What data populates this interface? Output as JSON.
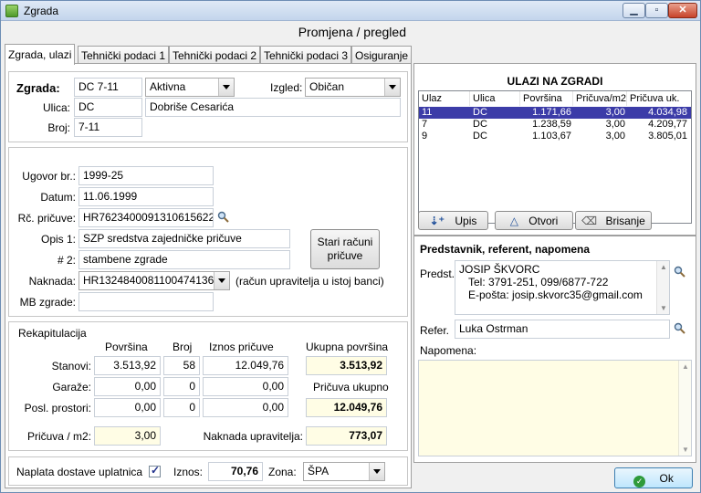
{
  "window": {
    "title": "Zgrada",
    "header": "Promjena / pregled"
  },
  "tabs": [
    {
      "label": "Zgrada, ulazi"
    },
    {
      "label": "Tehnički podaci 1"
    },
    {
      "label": "Tehnički podaci 2"
    },
    {
      "label": "Tehnički podaci 3"
    },
    {
      "label": "Osiguranje"
    }
  ],
  "building": {
    "zgrada_label": "Zgrada:",
    "zgrada_value": "DC 7-11",
    "status_value": "Aktivna",
    "izgled_label": "Izgled:",
    "izgled_value": "Običan",
    "ulica_label": "Ulica:",
    "ulica_code": "DC",
    "ulica_name": "Dobriše Cesarića",
    "broj_label": "Broj:",
    "broj_value": "7-11"
  },
  "contract": {
    "ugovor_label": "Ugovor br.:",
    "ugovor_value": "1999-25",
    "datum_label": "Datum:",
    "datum_value": "11.06.1999",
    "rc_label": "Rč. pričuve:",
    "rc_value": "HR7623400091310615622",
    "opis1_label": "Opis 1:",
    "opis1_value": "SZP sredstva zajedničke pričuve",
    "opis2_label": "# 2:",
    "opis2_value": "stambene zgrade",
    "stari_button": "Stari računi pričuve",
    "naknada_label": "Naknada:",
    "naknada_value": "HR1324840081100474136",
    "naknada_note": "(račun upravitelja u istoj banci)",
    "mb_label": "MB zgrade:",
    "mb_value": ""
  },
  "recap": {
    "title": "Rekapitulacija",
    "headers": {
      "povrsina": "Površina",
      "broj": "Broj",
      "iznos": "Iznos pričuve",
      "ukupna": "Ukupna površina"
    },
    "rows": [
      {
        "label": "Stanovi:",
        "povrsina": "3.513,92",
        "broj": "58",
        "iznos": "12.049,76"
      },
      {
        "label": "Garaže:",
        "povrsina": "0,00",
        "broj": "0",
        "iznos": "0,00"
      },
      {
        "label": "Posl. prostori:",
        "povrsina": "0,00",
        "broj": "0",
        "iznos": "0,00"
      }
    ],
    "ukupna_value": "3.513,92",
    "pricuva_ukupno_label": "Pričuva ukupno",
    "pricuva_ukupno_value": "12.049,76"
  },
  "rates": {
    "pricuva_m2_label": "Pričuva / m2:",
    "pricuva_m2_value": "3,00",
    "naknada_label": "Naknada upravitelja:",
    "naknada_value": "773,07"
  },
  "delivery": {
    "label": "Naplata dostave uplatnica",
    "checked": true,
    "iznos_label": "Iznos:",
    "iznos_value": "70,76",
    "zona_label": "Zona:",
    "zona_value": "ŠPA"
  },
  "entrances": {
    "title": "ULAZI NA ZGRADI",
    "columns": [
      "Ulaz",
      "Ulica",
      "Površina",
      "Pričuva/m2",
      "Pričuva uk."
    ],
    "rows": [
      {
        "ulaz": "11",
        "ulica": "DC",
        "povrsina": "1.171,66",
        "pricuva_m2": "3,00",
        "pricuva_uk": "4.034,98"
      },
      {
        "ulaz": "7",
        "ulica": "DC",
        "povrsina": "1.238,59",
        "pricuva_m2": "3,00",
        "pricuva_uk": "4.209,77"
      },
      {
        "ulaz": "9",
        "ulica": "DC",
        "povrsina": "1.103,67",
        "pricuva_m2": "3,00",
        "pricuva_uk": "3.805,01"
      }
    ],
    "buttons": {
      "upis": "Upis",
      "otvori": "Otvori",
      "brisanje": "Brisanje"
    }
  },
  "representative": {
    "title": "Predstavnik, referent, napomena",
    "predst_label": "Predst.",
    "predst_lines": [
      "JOSIP ŠKVORC",
      "Tel: 3791-251, 099/6877-722",
      "E-pošta: josip.skvorc35@gmail.com"
    ],
    "refer_label": "Refer.",
    "refer_value": "Luka Ostrman",
    "napomena_label": "Napomena:",
    "napomena_value": ""
  },
  "footer": {
    "ok_label": "Ok"
  },
  "colors": {
    "selection": "#3c3ca8",
    "highlight_field": "#fffde5",
    "title_bar": "#c3d5ec"
  }
}
